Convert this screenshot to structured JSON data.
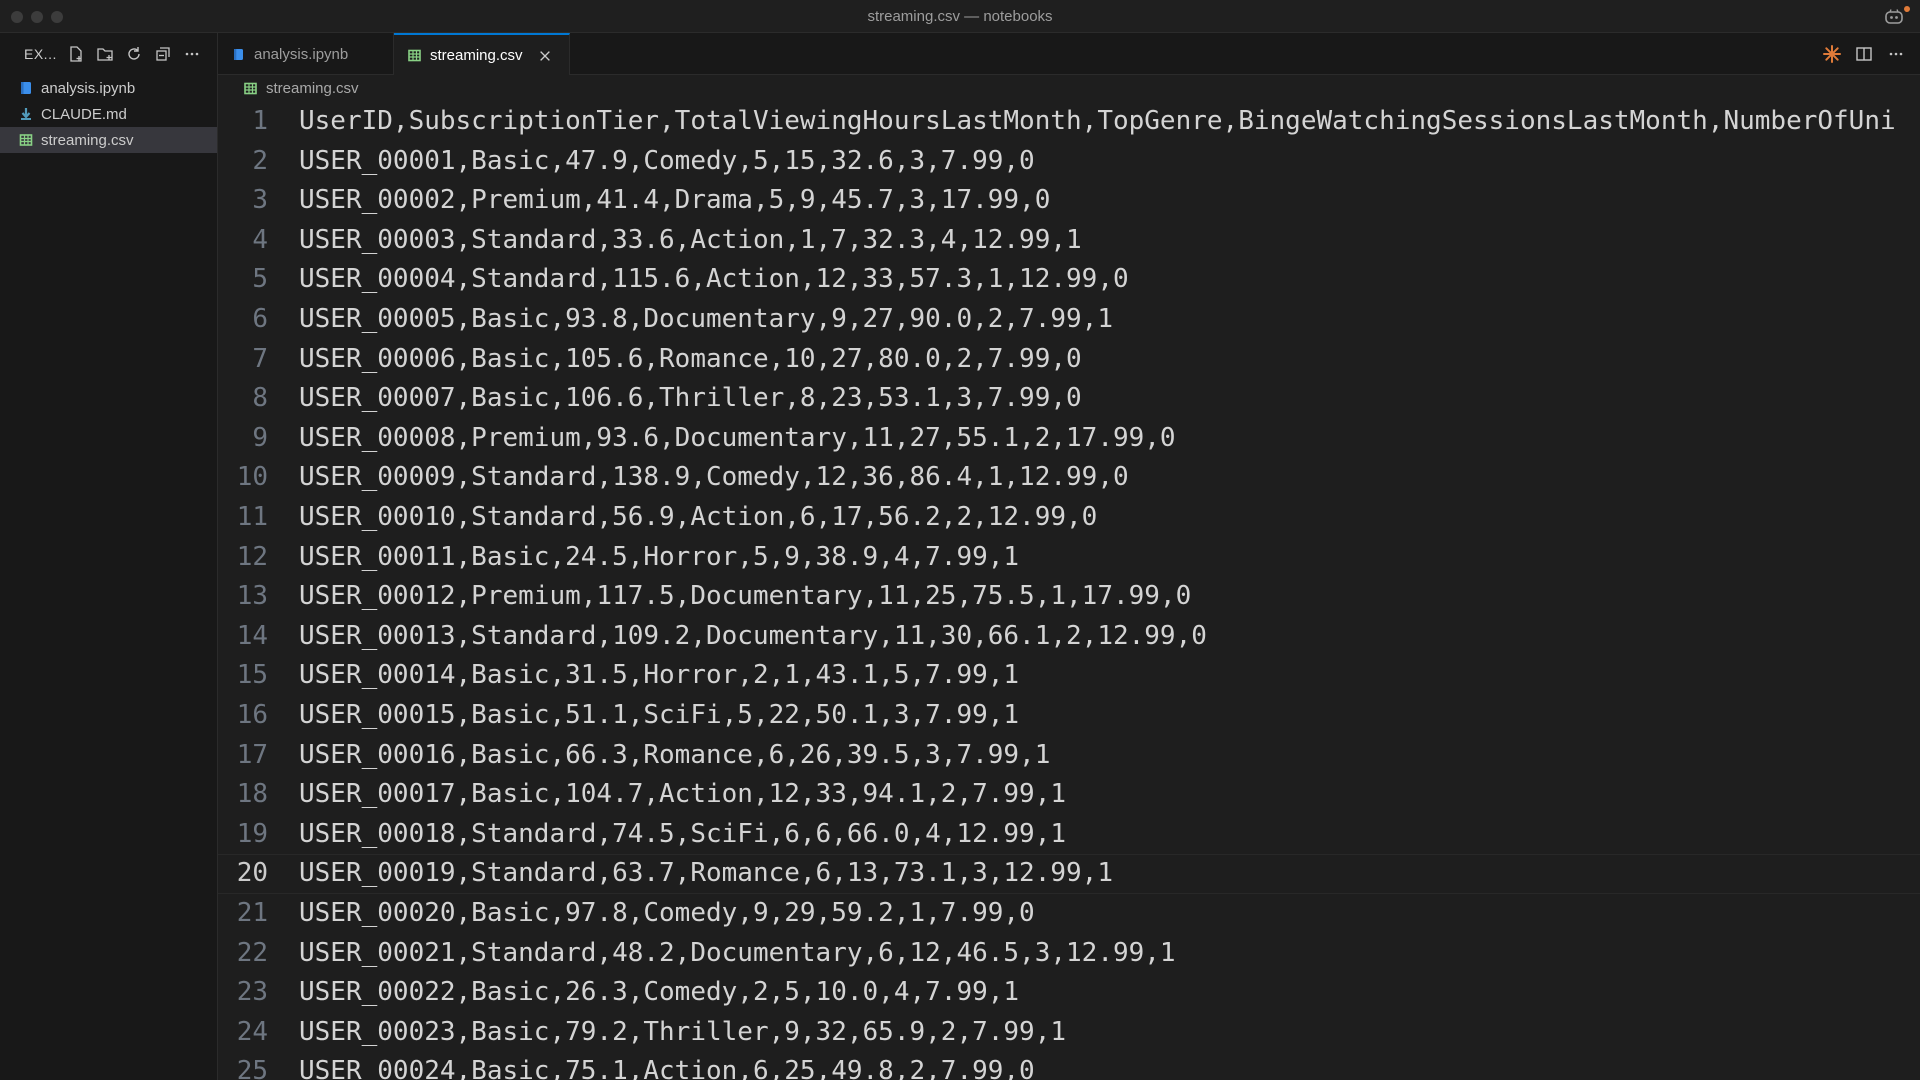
{
  "window": {
    "title": "streaming.csv — notebooks"
  },
  "sidebar": {
    "title": "EX...",
    "files": [
      {
        "name": "analysis.ipynb",
        "icon": "notebook-icon",
        "color": "#3b8eea"
      },
      {
        "name": "CLAUDE.md",
        "icon": "markdown-icon",
        "color": "#519aba"
      },
      {
        "name": "streaming.csv",
        "icon": "csv-icon",
        "color": "#89d185"
      }
    ]
  },
  "tabs": [
    {
      "label": "analysis.ipynb",
      "active": false
    },
    {
      "label": "streaming.csv",
      "active": true
    }
  ],
  "breadcrumb": {
    "file": "streaming.csv"
  },
  "editor": {
    "current_line": 20,
    "lines": [
      {
        "n": "1",
        "text": "UserID,SubscriptionTier,TotalViewingHoursLastMonth,TopGenre,BingeWatchingSessionsLastMonth,NumberOfUni"
      },
      {
        "n": "2",
        "text": "USER_00001,Basic,47.9,Comedy,5,15,32.6,3,7.99,0"
      },
      {
        "n": "3",
        "text": "USER_00002,Premium,41.4,Drama,5,9,45.7,3,17.99,0"
      },
      {
        "n": "4",
        "text": "USER_00003,Standard,33.6,Action,1,7,32.3,4,12.99,1"
      },
      {
        "n": "5",
        "text": "USER_00004,Standard,115.6,Action,12,33,57.3,1,12.99,0"
      },
      {
        "n": "6",
        "text": "USER_00005,Basic,93.8,Documentary,9,27,90.0,2,7.99,1"
      },
      {
        "n": "7",
        "text": "USER_00006,Basic,105.6,Romance,10,27,80.0,2,7.99,0"
      },
      {
        "n": "8",
        "text": "USER_00007,Basic,106.6,Thriller,8,23,53.1,3,7.99,0"
      },
      {
        "n": "9",
        "text": "USER_00008,Premium,93.6,Documentary,11,27,55.1,2,17.99,0"
      },
      {
        "n": "10",
        "text": "USER_00009,Standard,138.9,Comedy,12,36,86.4,1,12.99,0"
      },
      {
        "n": "11",
        "text": "USER_00010,Standard,56.9,Action,6,17,56.2,2,12.99,0"
      },
      {
        "n": "12",
        "text": "USER_00011,Basic,24.5,Horror,5,9,38.9,4,7.99,1"
      },
      {
        "n": "13",
        "text": "USER_00012,Premium,117.5,Documentary,11,25,75.5,1,17.99,0"
      },
      {
        "n": "14",
        "text": "USER_00013,Standard,109.2,Documentary,11,30,66.1,2,12.99,0"
      },
      {
        "n": "15",
        "text": "USER_00014,Basic,31.5,Horror,2,1,43.1,5,7.99,1"
      },
      {
        "n": "16",
        "text": "USER_00015,Basic,51.1,SciFi,5,22,50.1,3,7.99,1"
      },
      {
        "n": "17",
        "text": "USER_00016,Basic,66.3,Romance,6,26,39.5,3,7.99,1"
      },
      {
        "n": "18",
        "text": "USER_00017,Basic,104.7,Action,12,33,94.1,2,7.99,1"
      },
      {
        "n": "19",
        "text": "USER_00018,Standard,74.5,SciFi,6,6,66.0,4,12.99,1"
      },
      {
        "n": "20",
        "text": "USER_00019,Standard,63.7,Romance,6,13,73.1,3,12.99,1"
      },
      {
        "n": "21",
        "text": "USER_00020,Basic,97.8,Comedy,9,29,59.2,1,7.99,0"
      },
      {
        "n": "22",
        "text": "USER_00021,Standard,48.2,Documentary,6,12,46.5,3,12.99,1"
      },
      {
        "n": "23",
        "text": "USER_00022,Basic,26.3,Comedy,2,5,10.0,4,7.99,1"
      },
      {
        "n": "24",
        "text": "USER_00023,Basic,79.2,Thriller,9,32,65.9,2,7.99,1"
      },
      {
        "n": "25",
        "text": "USER_00024,Basic,75.1,Action,6,25,49.8,2,7.99,0"
      }
    ]
  },
  "colors": {
    "accent": "#0078d4",
    "claude_icon": "#e07b39",
    "csv_icon": "#89d185",
    "notebook_icon": "#3b8eea"
  }
}
